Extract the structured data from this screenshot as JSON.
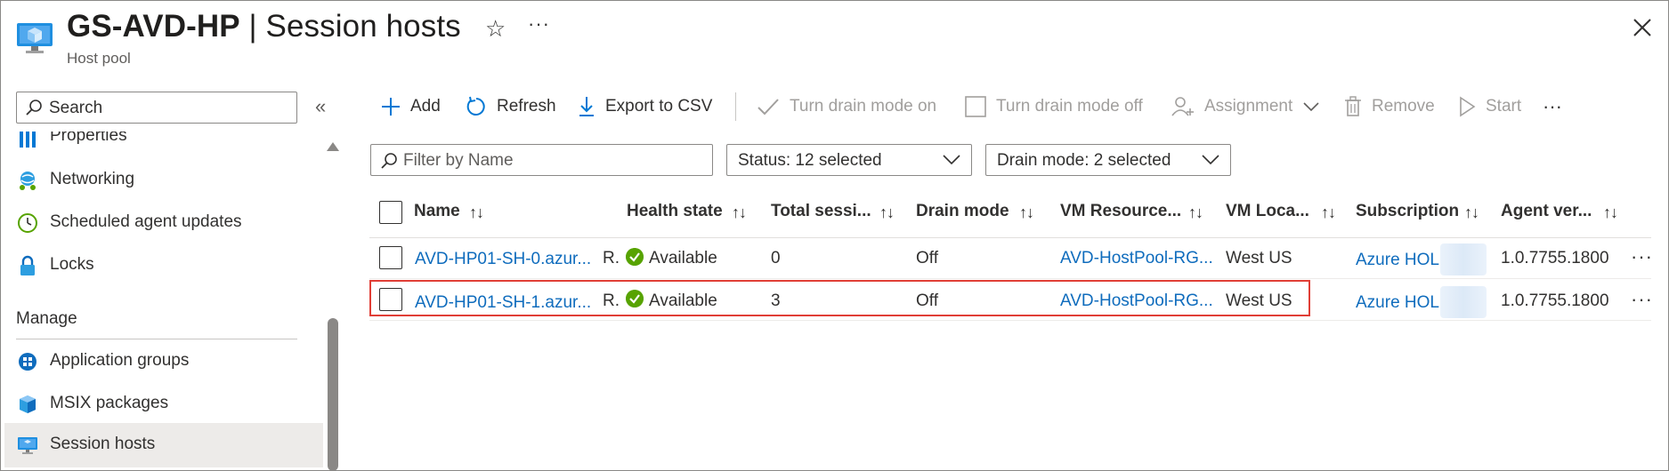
{
  "header": {
    "title_bold": "GS-AVD-HP",
    "title_rest": " | Session hosts",
    "subtitle": "Host pool",
    "more": "···"
  },
  "sidebar": {
    "search_placeholder": "Search",
    "collapse": "«",
    "items": [
      {
        "label": "Properties"
      },
      {
        "label": "Networking"
      },
      {
        "label": "Scheduled agent updates"
      },
      {
        "label": "Locks"
      }
    ],
    "section": "Manage",
    "manage_items": [
      {
        "label": "Application groups"
      },
      {
        "label": "MSIX packages"
      },
      {
        "label": "Session hosts"
      }
    ]
  },
  "toolbar": {
    "add": "Add",
    "refresh": "Refresh",
    "export": "Export to CSV",
    "drain_on": "Turn drain mode on",
    "drain_off": "Turn drain mode off",
    "assignment": "Assignment",
    "remove": "Remove",
    "start": "Start",
    "more": "···"
  },
  "filters": {
    "name_placeholder": "Filter by Name",
    "status": "Status: 12 selected",
    "drain": "Drain mode: 2 selected"
  },
  "table": {
    "columns": [
      "Name",
      "Health state",
      "Total sessi...",
      "Drain mode",
      "VM Resource...",
      "VM Loca...",
      "Subscription",
      "Agent ver..."
    ],
    "sort_glyph": "↑↓",
    "rows": [
      {
        "name": "AVD-HP01-SH-0.azur...",
        "status": "R.",
        "health": "Available",
        "sessions": "0",
        "drain": "Off",
        "rg": "AVD-HostPool-RG...",
        "location": "West US",
        "subscription": "Azure HOL",
        "agent": "1.0.7755.1800",
        "more": "···"
      },
      {
        "name": "AVD-HP01-SH-1.azur...",
        "status": "R.",
        "health": "Available",
        "sessions": "3",
        "drain": "Off",
        "rg": "AVD-HostPool-RG...",
        "location": "West US",
        "subscription": "Azure HOL",
        "agent": "1.0.7755.1800",
        "more": "···"
      }
    ]
  },
  "colors": {
    "link": "#0f6cbd",
    "available": "#57a300",
    "highlight": "#e03e36",
    "accent": "#0078d4"
  }
}
